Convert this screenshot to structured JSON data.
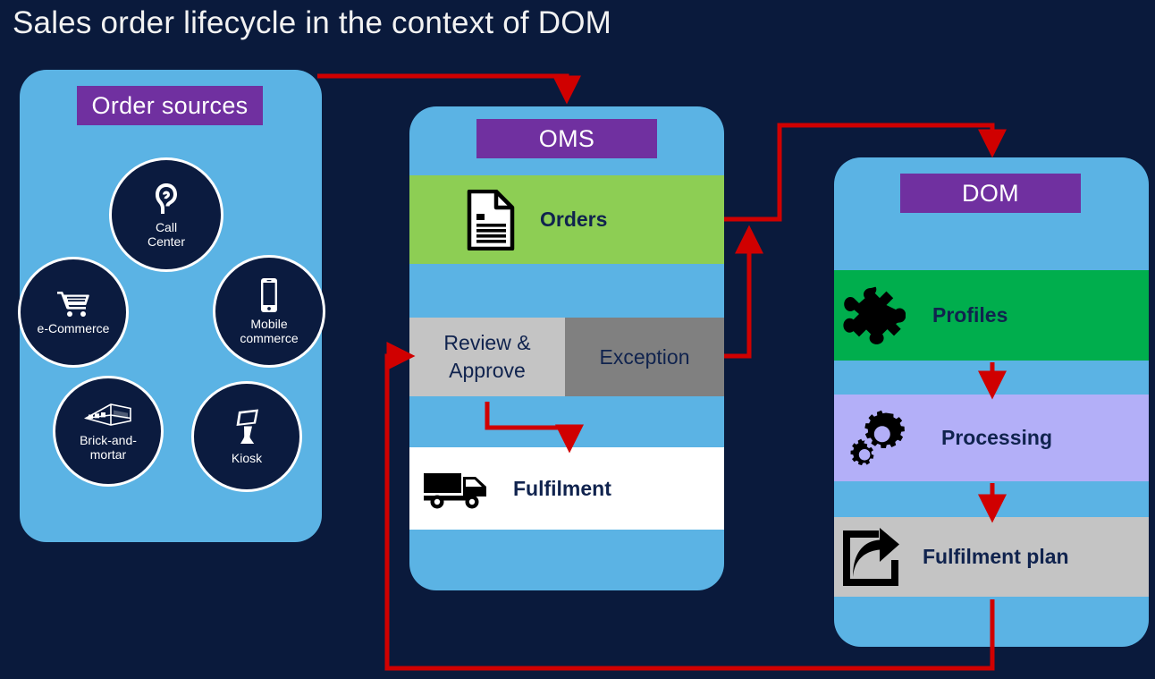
{
  "page": {
    "title": "Sales order lifecycle in the context of DOM",
    "background_color": "#0A1A3C"
  },
  "colors": {
    "panel_blue": "#5BB3E4",
    "title_purple": "#7030A0",
    "orders_green": "#8DCE54",
    "profiles_green": "#00AE4D",
    "processing_lavender": "#B3AFF8",
    "light_gray": "#C4C4C4",
    "dark_gray": "#808080",
    "white": "#FFFFFF",
    "arrow_red": "#D00000",
    "circle_navy": "#0B1B3F",
    "band_text": "#10234E"
  },
  "order_sources": {
    "title": "Order sources",
    "title_icon": "purple-label-box",
    "items": [
      {
        "label": "Call\nCenter",
        "label_line1": "Call",
        "label_line2": "Center",
        "icon": "ear-icon"
      },
      {
        "label": "e-Commerce",
        "label_line1": "e-Commerce",
        "label_line2": "",
        "icon": "shopping-cart-icon"
      },
      {
        "label": "Mobile commerce",
        "label_line1": "Mobile",
        "label_line2": "commerce",
        "icon": "mobile-phone-icon"
      },
      {
        "label": "Brick-and-mortar",
        "label_line1": "Brick-and-",
        "label_line2": "mortar",
        "icon": "warehouse-icon"
      },
      {
        "label": "Kiosk",
        "label_line1": "Kiosk",
        "label_line2": "",
        "icon": "kiosk-icon"
      }
    ]
  },
  "oms": {
    "title": "OMS",
    "bands": [
      {
        "label": "Orders",
        "icon": "document-icon",
        "color": "#8DCE54"
      },
      {
        "label": "Fulfilment",
        "icon": "delivery-truck-icon",
        "color": "#FFFFFF"
      }
    ],
    "split_band": {
      "left": {
        "label": "Review & Approve",
        "line1": "Review &",
        "line2": "Approve",
        "color": "#C4C4C4"
      },
      "right": {
        "label": "Exception",
        "line1": "Exception",
        "line2": "",
        "color": "#808080"
      }
    }
  },
  "dom": {
    "title": "DOM",
    "bands": [
      {
        "label": "Profiles",
        "icon": "puzzle-piece-icon",
        "color": "#00AE4D"
      },
      {
        "label": "Processing",
        "icon": "gears-icon",
        "color": "#B3AFF8"
      },
      {
        "label": "Fulfilment plan",
        "icon": "share-export-icon",
        "color": "#C4C4C4"
      }
    ]
  },
  "connectors": [
    {
      "name": "order-sources-to-oms",
      "from": "Order sources",
      "to": "OMS",
      "style": "elbow-right-down"
    },
    {
      "name": "oms-orders-to-dom",
      "from": "Orders",
      "to": "DOM",
      "style": "elbow-up-right-down"
    },
    {
      "name": "exception-back-to-orders",
      "from": "Exception",
      "to": "Orders",
      "style": "elbow-right-up"
    },
    {
      "name": "review-approve-to-fulfilment",
      "from": "Review & Approve",
      "to": "Fulfilment",
      "style": "elbow-down-right-down"
    },
    {
      "name": "dom-back-to-review-approve",
      "from": "DOM",
      "to": "Review & Approve",
      "style": "loop-down-left-up"
    },
    {
      "name": "profiles-to-processing",
      "from": "Profiles",
      "to": "Processing",
      "style": "straight-down"
    },
    {
      "name": "processing-to-fulfilment-plan",
      "from": "Processing",
      "to": "Fulfilment plan",
      "style": "straight-down"
    }
  ]
}
